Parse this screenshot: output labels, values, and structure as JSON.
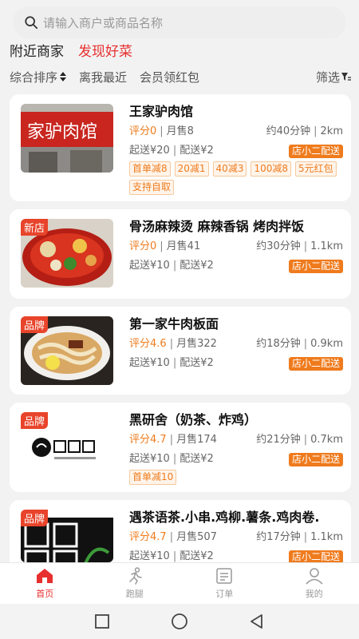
{
  "search": {
    "placeholder": "请输入商户或商品名称"
  },
  "top_tabs": [
    {
      "label": "附近商家",
      "active": false
    },
    {
      "label": "发现好菜",
      "active": true
    }
  ],
  "filters": {
    "sort": "综合排序",
    "nearest": "离我最近",
    "member": "会员领红包",
    "filter": "筛选"
  },
  "stores": [
    {
      "name": "王家驴肉馆",
      "badge": "",
      "rating": "评分0",
      "monthly_sales": "月售8",
      "time": "约40分钟",
      "distance": "2km",
      "min_order": "起送¥20",
      "delivery_fee": "配送¥2",
      "delivery_label": "店小二配送",
      "tags": [
        "首单减8",
        "20减1",
        "40减3",
        "100减8",
        "5元红包",
        "支持自取"
      ]
    },
    {
      "name": "骨汤麻辣烫 麻辣香锅 烤肉拌饭",
      "badge": "新店",
      "rating": "评分0",
      "monthly_sales": "月售41",
      "time": "约30分钟",
      "distance": "1.1km",
      "min_order": "起送¥10",
      "delivery_fee": "配送¥2",
      "delivery_label": "店小二配送",
      "tags": []
    },
    {
      "name": "第一家牛肉板面",
      "badge": "品牌",
      "rating": "评分4.6",
      "monthly_sales": "月售322",
      "time": "约18分钟",
      "distance": "0.9km",
      "min_order": "起送¥10",
      "delivery_fee": "配送¥2",
      "delivery_label": "店小二配送",
      "tags": []
    },
    {
      "name": "黑研舍（奶茶、炸鸡）",
      "badge": "品牌",
      "rating": "评分4.7",
      "monthly_sales": "月售174",
      "time": "约21分钟",
      "distance": "0.7km",
      "min_order": "起送¥10",
      "delivery_fee": "配送¥2",
      "delivery_label": "店小二配送",
      "tags": [
        "首单减10"
      ]
    },
    {
      "name": "遇茶语茶.小串.鸡柳.薯条.鸡肉卷.",
      "badge": "品牌",
      "rating": "评分4.7",
      "monthly_sales": "月售507",
      "time": "约17分钟",
      "distance": "1.1km",
      "min_order": "起送¥10",
      "delivery_fee": "配送¥2",
      "delivery_label": "店小二配送",
      "tags": []
    }
  ],
  "bottom_nav": [
    {
      "label": "首页",
      "icon": "home-icon",
      "active": true
    },
    {
      "label": "跑腿",
      "icon": "runner-icon",
      "active": false
    },
    {
      "label": "订单",
      "icon": "order-list-icon",
      "active": false
    },
    {
      "label": "我的",
      "icon": "user-icon",
      "active": false
    }
  ],
  "colors": {
    "accent": "#e82f2f",
    "orange": "#ef7b1d"
  }
}
